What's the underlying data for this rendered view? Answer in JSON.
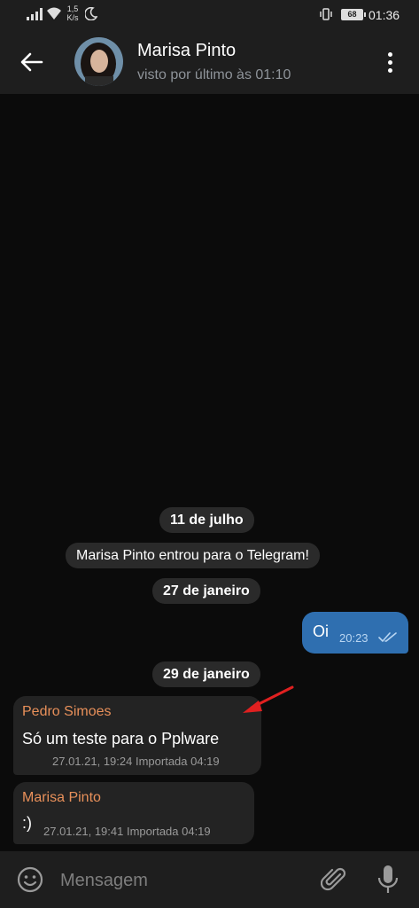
{
  "status_bar": {
    "speed_value": "1,5",
    "speed_unit": "K/s",
    "battery": "68",
    "time": "01:36"
  },
  "header": {
    "title": "Marisa Pinto",
    "status": "visto por último às 01:10"
  },
  "messages": [
    {
      "type": "date",
      "text": "11 de julho"
    },
    {
      "type": "service",
      "text": "Marisa Pinto entrou para o Telegram!"
    },
    {
      "type": "date",
      "text": "27 de janeiro"
    },
    {
      "type": "outgoing",
      "text": "Oi",
      "time": "20:23",
      "read": true
    },
    {
      "type": "date",
      "text": "29 de janeiro"
    },
    {
      "type": "incoming",
      "sender": "Pedro Simoes",
      "text": "Só um teste para o Pplware",
      "meta": "27.01.21, 19:24 Importada 04:19"
    },
    {
      "type": "incoming",
      "sender": "Marisa Pinto",
      "text": ":)",
      "meta": "27.01.21, 19:41 Importada 04:19"
    }
  ],
  "input": {
    "placeholder": "Mensagem"
  },
  "colors": {
    "header_bg": "#1e1e1e",
    "chat_bg": "#0b0b0b",
    "outgoing_bubble": "#2f6fb0",
    "incoming_bubble": "#232323",
    "sender_name": "#e8905a",
    "annotation_arrow": "#e02020"
  },
  "icons": [
    "signal-icon",
    "wifi-icon",
    "moon-icon",
    "vibrate-icon",
    "back-arrow-icon",
    "more-vert-icon",
    "double-check-icon",
    "emoji-icon",
    "attach-icon",
    "mic-icon"
  ]
}
